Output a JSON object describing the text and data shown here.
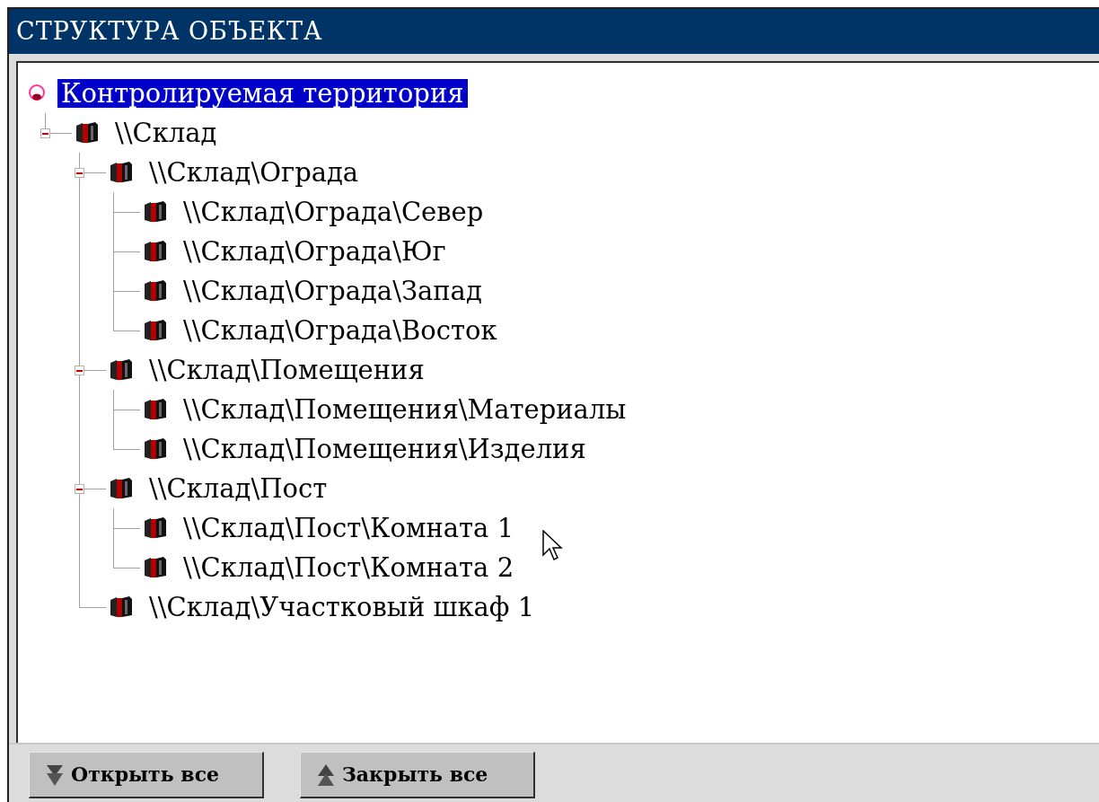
{
  "window": {
    "title": "СТРУКТУРА ОБЪЕКТА"
  },
  "tree": [
    {
      "label": "Контролируемая территория",
      "kind": "territory",
      "selected": true,
      "children": [
        {
          "label": "\\\\Склад",
          "kind": "building",
          "selected": false,
          "expanded": true,
          "children": [
            {
              "label": "\\\\Склад\\Ограда",
              "kind": "building",
              "selected": false,
              "expanded": true,
              "children": [
                {
                  "label": "\\\\Склад\\Ограда\\Север",
                  "kind": "building",
                  "selected": false
                },
                {
                  "label": "\\\\Склад\\Ограда\\Юг",
                  "kind": "building",
                  "selected": false
                },
                {
                  "label": "\\\\Склад\\Ограда\\Запад",
                  "kind": "building",
                  "selected": false
                },
                {
                  "label": "\\\\Склад\\Ограда\\Восток",
                  "kind": "building",
                  "selected": false
                }
              ]
            },
            {
              "label": "\\\\Склад\\Помещения",
              "kind": "building",
              "selected": false,
              "expanded": true,
              "children": [
                {
                  "label": "\\\\Склад\\Помещения\\Материалы",
                  "kind": "building",
                  "selected": false
                },
                {
                  "label": "\\\\Склад\\Помещения\\Изделия",
                  "kind": "building",
                  "selected": false
                }
              ]
            },
            {
              "label": "\\\\Склад\\Пост",
              "kind": "building",
              "selected": false,
              "expanded": true,
              "children": [
                {
                  "label": "\\\\Склад\\Пост\\Комната 1",
                  "kind": "building",
                  "selected": false
                },
                {
                  "label": "\\\\Склад\\Пост\\Комната 2",
                  "kind": "building",
                  "selected": false
                }
              ]
            },
            {
              "label": "\\\\Склад\\Участковый шкаф 1",
              "kind": "building",
              "selected": false
            }
          ]
        }
      ]
    }
  ],
  "buttons": [
    {
      "label": "Открыть все",
      "kind": "expand"
    },
    {
      "label": "Закрыть все",
      "kind": "collapse"
    }
  ]
}
